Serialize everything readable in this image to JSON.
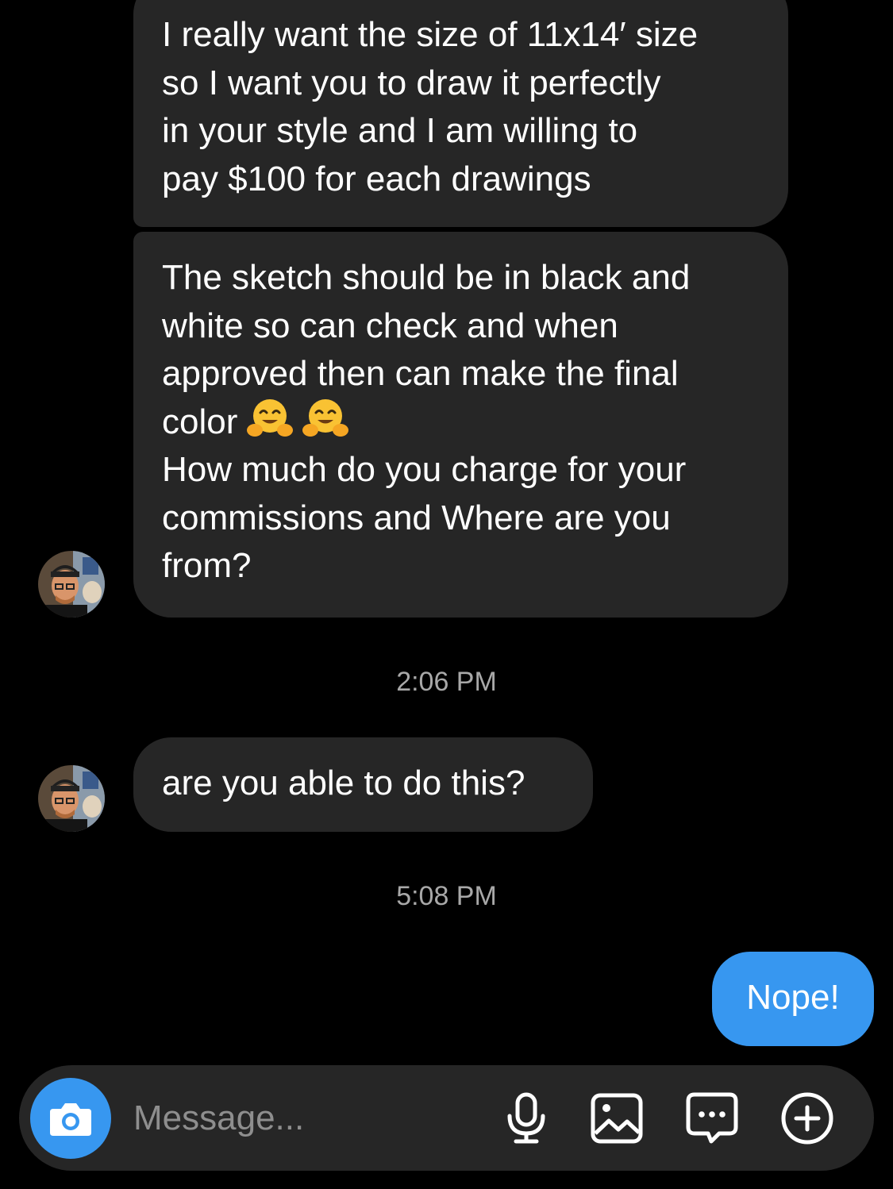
{
  "conversation": {
    "messages": [
      {
        "sender": "them",
        "text": "I really want the size of 11x14′ size\nso I want you to draw it perfectly\nin your style and I am willing to\npay $100 for each drawings"
      },
      {
        "sender": "them",
        "text_before_emoji": "The sketch should be in black and\nwhite so can check and when\napproved then can make the final\ncolor",
        "emoji": "hugging-face-emoji x2",
        "text_after_emoji": "\nHow much do you charge for your\ncommissions and Where are you\nfrom?"
      },
      {
        "timestamp": "2:06 PM"
      },
      {
        "sender": "them",
        "text": "are you able to do this?"
      },
      {
        "timestamp": "5:08 PM"
      },
      {
        "sender": "me",
        "text": "Nope!"
      }
    ]
  },
  "composer": {
    "placeholder": "Message...",
    "icons": [
      "camera-icon",
      "microphone-icon",
      "image-icon",
      "sticker-icon",
      "plus-icon"
    ]
  },
  "colors": {
    "background": "#000000",
    "incoming_bubble": "#262626",
    "outgoing_bubble": "#3797f0",
    "timestamp": "#a8a8a8",
    "placeholder": "#8e8e8e"
  }
}
